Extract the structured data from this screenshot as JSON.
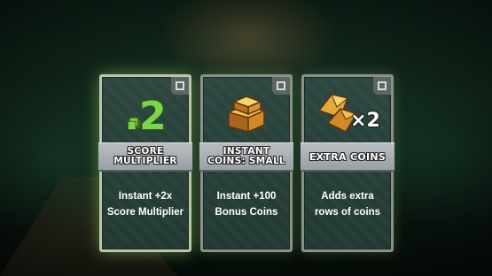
{
  "screen": {
    "name": "powerup-card-selection"
  },
  "cards": [
    {
      "id": "score-multiplier",
      "title": "SCORE\nMULTIPLIER",
      "description": "Instant +2x\nScore Multiplier",
      "icon": "green-2x-multiplier-icon",
      "icon_text": ".2"
    },
    {
      "id": "instant-coins-small",
      "title": "INSTANT\nCOINS: SMALL",
      "description": "Instant +100\nBonus Coins",
      "icon": "gold-coin-stack-icon"
    },
    {
      "id": "extra-coins",
      "title": "EXTRA COINS",
      "description": "Adds extra\nrows of coins",
      "icon": "gold-coins-x2-icon",
      "icon_text": "×2"
    }
  ],
  "colors": {
    "card_border": "#8a9288",
    "card_bg": "#2d4640",
    "banner": "#b9bec2",
    "green_icon": "#7bd44a",
    "gold_icon": "#e3a93a"
  }
}
